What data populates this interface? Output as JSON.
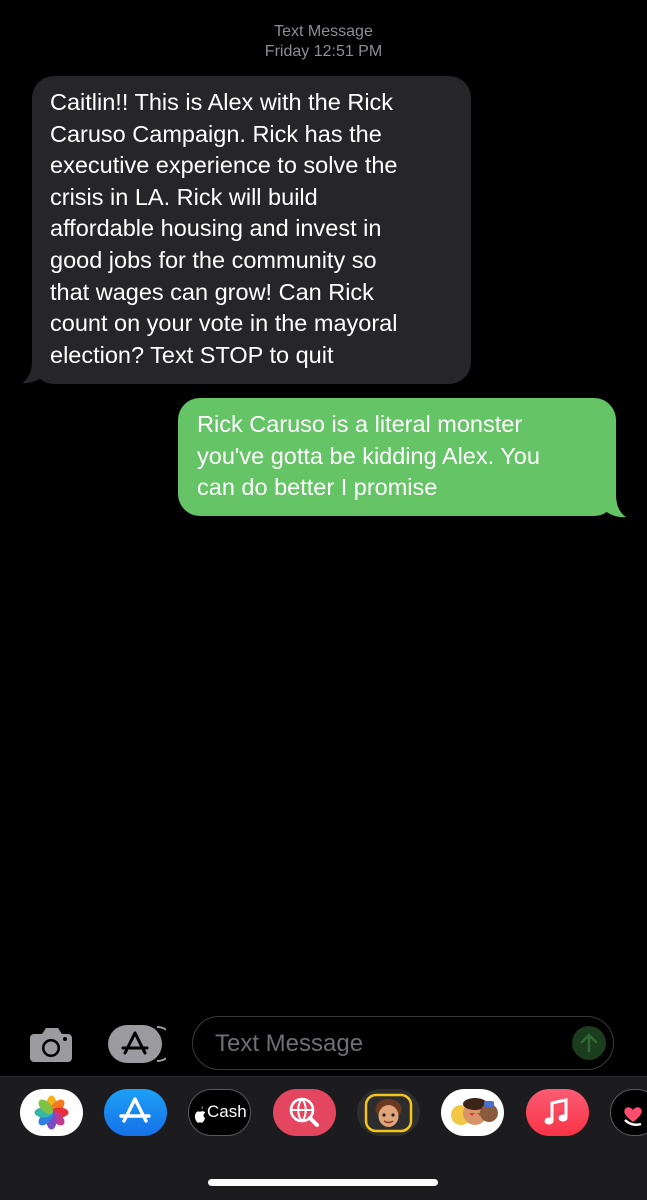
{
  "header": {
    "service": "Text Message",
    "timestamp": "Friday 12:51 PM"
  },
  "messages": [
    {
      "direction": "received",
      "text": "Caitlin!! This is Alex with the Rick\nCaruso Campaign. Rick has the\nexecutive experience to solve the\ncrisis in LA.  Rick will build\naffordable housing and invest in\ngood jobs for the community so\nthat wages can grow!  Can Rick\ncount on your vote in the mayoral\nelection? Text STOP to quit"
    },
    {
      "direction": "sent",
      "text": "Rick Caruso is a literal monster\nyou've gotta be kidding Alex. You\ncan do better I promise"
    }
  ],
  "composer": {
    "placeholder": "Text Message"
  },
  "app_drawer": {
    "cash_label": "Cash",
    "icons": [
      "photos-icon",
      "app-store-icon",
      "apple-cash-icon",
      "images-search-icon",
      "memoji-icon",
      "memoji-stickers-icon",
      "music-icon",
      "digital-touch-icon"
    ]
  },
  "colors": {
    "received_bubble": "#262628",
    "sent_bubble": "#65c466",
    "background": "#000000"
  }
}
